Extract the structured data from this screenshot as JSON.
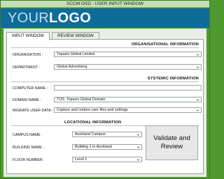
{
  "window": {
    "title": "SCCM OSD : USER INPUT WINDOW"
  },
  "logo": {
    "your": "YOUR",
    "logo": "LOGO"
  },
  "tabs": [
    {
      "label": "INPUT WINDOW",
      "active": true
    },
    {
      "label": "REVIEW WINDOW",
      "active": false
    }
  ],
  "sections": {
    "organisational": {
      "title": "ORGANISATIONAL INFORMATION",
      "fields": [
        {
          "label": "ORGANISATION :",
          "value": "Topazix Global Limited"
        },
        {
          "label": "DEPARTMENT :",
          "value": "Global Advertising"
        }
      ]
    },
    "systemic": {
      "title": "SYSTEMIC INFORMATION",
      "fields": [
        {
          "label": "COMPUTER NAME :",
          "value": ""
        },
        {
          "label": "DOMAIN NAME :",
          "value": "TUS-  Topazix Global Domain"
        },
        {
          "label": "MIGRATE USER DATA :",
          "value": "Capture and restore user files and settings"
        }
      ]
    },
    "locational": {
      "title": "LOCATIONAL INFORMATION",
      "fields": [
        {
          "label": "CAMPUS NAME :",
          "value": "Auckland Campus"
        },
        {
          "label": "BUILDING NAME :",
          "value": "Building 1 in Auckland"
        },
        {
          "label": "FLOOR NUMBER :",
          "value": "Level 1"
        }
      ]
    }
  },
  "validate_button": {
    "label": "Validate and Review"
  },
  "colors": {
    "frame": "#4f9a2e",
    "header": "#0f6c98",
    "panel": "#ffffff"
  },
  "icons": {
    "dropdown": "chevron-down-icon"
  }
}
